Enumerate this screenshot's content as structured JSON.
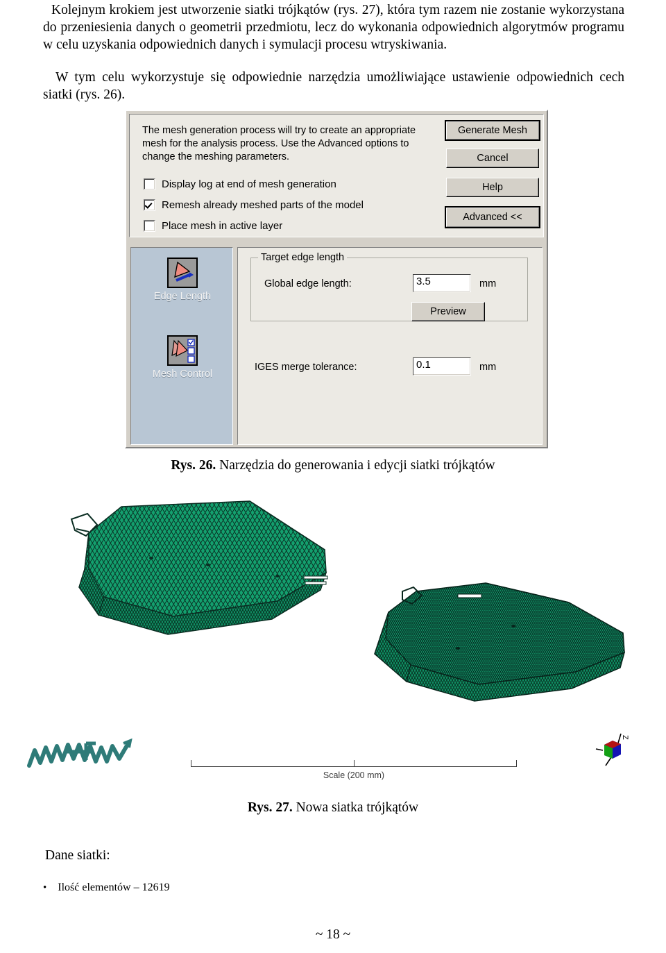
{
  "document": {
    "paragraph_1": "Kolejnym krokiem jest utworzenie siatki trójkątów (rys. 27), która tym razem nie zostanie wykorzystana do przeniesienia danych o geometrii przedmiotu, lecz do wykonania odpowiednich algorytmów programu w celu uzyskania odpowiednich danych i symulacji procesu wtryskiwania.",
    "paragraph_2": "W tym celu wykorzystuje się odpowiednie narzędzia umożliwiające ustawienie odpowiednich cech siatki (rys. 26).",
    "page_number": "~ 18 ~"
  },
  "dialog": {
    "description": "The mesh generation process will try to create an appropriate mesh for the analysis process. Use the Advanced options to change the meshing parameters.",
    "checkboxes": [
      {
        "label": "Display log at end of mesh generation",
        "checked": false
      },
      {
        "label": "Remesh already meshed parts of the model",
        "checked": true
      },
      {
        "label": "Place mesh in active layer",
        "checked": false
      }
    ],
    "buttons": [
      {
        "label": "Generate Mesh",
        "default": true
      },
      {
        "label": "Cancel",
        "default": false
      },
      {
        "label": "Help",
        "default": false
      },
      {
        "label": "Advanced <<",
        "default": true
      }
    ],
    "rail": [
      {
        "label": "Edge Length",
        "icon": "triangle-arrow-icon",
        "selected": true
      },
      {
        "label": "Mesh Control",
        "icon": "triangle-checklist-icon",
        "selected": false
      }
    ],
    "group": {
      "title": "Target edge length",
      "global_edge_length_label": "Global edge length:",
      "global_edge_length_value": "3.5",
      "global_edge_length_unit": "mm",
      "preview_button": "Preview"
    },
    "iges": {
      "label": "IGES merge tolerance:",
      "value": "0.1",
      "unit": "mm"
    },
    "colors": {
      "face": "#d4d0c8",
      "pane": "#eceae4",
      "rail": "#b8c6d4",
      "icon_triangle": "#ef8b80",
      "icon_arrow": "#1a2fbf"
    }
  },
  "figures": {
    "caption_26_bold": "Rys. 26.",
    "caption_26_text": " Narzędzia do generowania i edycji siatki trójkątów",
    "caption_27_bold": "Rys. 27.",
    "caption_27_text": " Nowa siatka trójkątów",
    "scale_label": "Scale (200 mm)",
    "logo_text": "moldflow",
    "axis_label": "Z",
    "mesh_color_fill": "#13a06e",
    "mesh_color_line": "#0a2d22"
  },
  "mesh_data": {
    "heading": "Dane siatki:",
    "items": [
      {
        "bullet": "•",
        "text": "Ilość elementów – 12619"
      }
    ]
  }
}
